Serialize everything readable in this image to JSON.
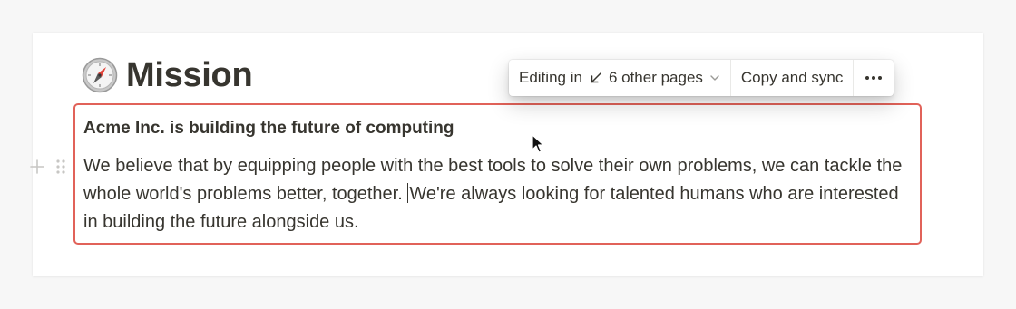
{
  "page": {
    "icon": "compass-icon",
    "title": "Mission"
  },
  "toolbar": {
    "editing_prefix": "Editing in",
    "editing_arrow_icon": "arrow-down-left-icon",
    "pages_label": "6 other pages",
    "chevron_icon": "chevron-down-icon",
    "copy_sync_label": "Copy and sync",
    "more_icon": "more-horizontal-icon"
  },
  "synced_block": {
    "border_color": "#e16259",
    "heading": "Acme Inc. is building the future of computing",
    "body_before_caret": "We believe that by equipping people with the best tools to solve their own problems, we can tackle the whole world's problems better, together. ",
    "body_after_caret": "We're always looking for talented humans who are interested in building the future alongside us."
  },
  "handles": {
    "plus_icon": "plus-icon",
    "drag_icon": "drag-handle-icon"
  }
}
